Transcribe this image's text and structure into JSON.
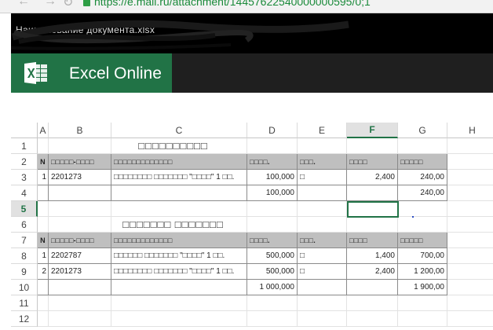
{
  "browser": {
    "url": "https://e.mail.ru/attachment/14457622540000000595/0;1"
  },
  "window": {
    "title_scribbled": "Наименование документа.xlsx"
  },
  "app": {
    "name": "Excel Online",
    "brand_color": "#217346"
  },
  "grid": {
    "columns": [
      "A",
      "B",
      "C",
      "D",
      "E",
      "F",
      "G",
      "H"
    ],
    "selected_column": "F",
    "rows": [
      "1",
      "2",
      "3",
      "4",
      "5",
      "6",
      "7",
      "8",
      "9",
      "10",
      "11",
      "12"
    ],
    "selected_row": "5",
    "active_cell": "F5"
  },
  "section1": {
    "title": "□□□□□□□□□□",
    "headers": {
      "n": "N",
      "code": "□□□□□-□□□□",
      "name": "□□□□□□□□□□□□□",
      "qty": "□□□□.",
      "unit": "□□□.",
      "price": "□□□□",
      "sum": "□□□□□"
    },
    "rows": [
      {
        "n": "1",
        "code": "2201273",
        "name": "□□□□□□□□ □□□□□□□ \"□□□□\" 1 □□.",
        "qty": "100,000",
        "unit": "□",
        "price": "2,400",
        "sum": "240,00"
      }
    ],
    "total_qty": "100,000",
    "total_sum": "240,00"
  },
  "section2": {
    "title": "□□□□□□□ □□□□□□□",
    "headers": {
      "n": "N",
      "code": "□□□□□-□□□□",
      "name": "□□□□□□□□□□□□□",
      "qty": "□□□□.",
      "unit": "□□□.",
      "price": "□□□□",
      "sum": "□□□□□"
    },
    "rows": [
      {
        "n": "1",
        "code": "2202787",
        "name": "□□□□□□ □□□□□□□ \"□□□□\" 1 □□.",
        "qty": "500,000",
        "unit": "□",
        "price": "1,400",
        "sum": "700,00"
      },
      {
        "n": "2",
        "code": "2201273",
        "name": "□□□□□□□□ □□□□□□□ \"□□□□\" 1 □□.",
        "qty": "500,000",
        "unit": "□",
        "price": "2,400",
        "sum": "1 200,00"
      }
    ],
    "total_qty": "1 000,000",
    "total_sum": "1 900,00"
  }
}
